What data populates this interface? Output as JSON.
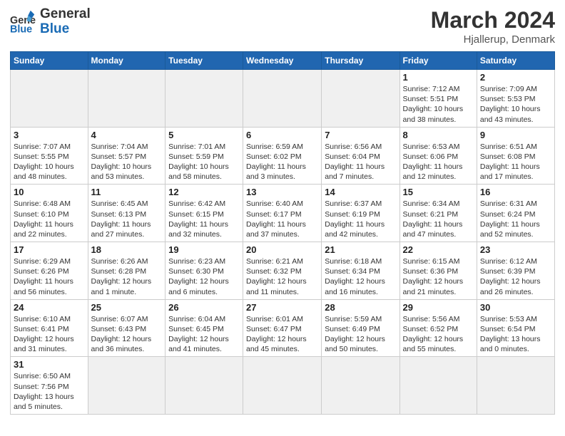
{
  "header": {
    "logo_general": "General",
    "logo_blue": "Blue",
    "month": "March 2024",
    "location": "Hjallerup, Denmark"
  },
  "weekdays": [
    "Sunday",
    "Monday",
    "Tuesday",
    "Wednesday",
    "Thursday",
    "Friday",
    "Saturday"
  ],
  "weeks": [
    [
      {
        "day": "",
        "info": ""
      },
      {
        "day": "",
        "info": ""
      },
      {
        "day": "",
        "info": ""
      },
      {
        "day": "",
        "info": ""
      },
      {
        "day": "",
        "info": ""
      },
      {
        "day": "1",
        "info": "Sunrise: 7:12 AM\nSunset: 5:51 PM\nDaylight: 10 hours and 38 minutes."
      },
      {
        "day": "2",
        "info": "Sunrise: 7:09 AM\nSunset: 5:53 PM\nDaylight: 10 hours and 43 minutes."
      }
    ],
    [
      {
        "day": "3",
        "info": "Sunrise: 7:07 AM\nSunset: 5:55 PM\nDaylight: 10 hours and 48 minutes."
      },
      {
        "day": "4",
        "info": "Sunrise: 7:04 AM\nSunset: 5:57 PM\nDaylight: 10 hours and 53 minutes."
      },
      {
        "day": "5",
        "info": "Sunrise: 7:01 AM\nSunset: 5:59 PM\nDaylight: 10 hours and 58 minutes."
      },
      {
        "day": "6",
        "info": "Sunrise: 6:59 AM\nSunset: 6:02 PM\nDaylight: 11 hours and 3 minutes."
      },
      {
        "day": "7",
        "info": "Sunrise: 6:56 AM\nSunset: 6:04 PM\nDaylight: 11 hours and 7 minutes."
      },
      {
        "day": "8",
        "info": "Sunrise: 6:53 AM\nSunset: 6:06 PM\nDaylight: 11 hours and 12 minutes."
      },
      {
        "day": "9",
        "info": "Sunrise: 6:51 AM\nSunset: 6:08 PM\nDaylight: 11 hours and 17 minutes."
      }
    ],
    [
      {
        "day": "10",
        "info": "Sunrise: 6:48 AM\nSunset: 6:10 PM\nDaylight: 11 hours and 22 minutes."
      },
      {
        "day": "11",
        "info": "Sunrise: 6:45 AM\nSunset: 6:13 PM\nDaylight: 11 hours and 27 minutes."
      },
      {
        "day": "12",
        "info": "Sunrise: 6:42 AM\nSunset: 6:15 PM\nDaylight: 11 hours and 32 minutes."
      },
      {
        "day": "13",
        "info": "Sunrise: 6:40 AM\nSunset: 6:17 PM\nDaylight: 11 hours and 37 minutes."
      },
      {
        "day": "14",
        "info": "Sunrise: 6:37 AM\nSunset: 6:19 PM\nDaylight: 11 hours and 42 minutes."
      },
      {
        "day": "15",
        "info": "Sunrise: 6:34 AM\nSunset: 6:21 PM\nDaylight: 11 hours and 47 minutes."
      },
      {
        "day": "16",
        "info": "Sunrise: 6:31 AM\nSunset: 6:24 PM\nDaylight: 11 hours and 52 minutes."
      }
    ],
    [
      {
        "day": "17",
        "info": "Sunrise: 6:29 AM\nSunset: 6:26 PM\nDaylight: 11 hours and 56 minutes."
      },
      {
        "day": "18",
        "info": "Sunrise: 6:26 AM\nSunset: 6:28 PM\nDaylight: 12 hours and 1 minute."
      },
      {
        "day": "19",
        "info": "Sunrise: 6:23 AM\nSunset: 6:30 PM\nDaylight: 12 hours and 6 minutes."
      },
      {
        "day": "20",
        "info": "Sunrise: 6:21 AM\nSunset: 6:32 PM\nDaylight: 12 hours and 11 minutes."
      },
      {
        "day": "21",
        "info": "Sunrise: 6:18 AM\nSunset: 6:34 PM\nDaylight: 12 hours and 16 minutes."
      },
      {
        "day": "22",
        "info": "Sunrise: 6:15 AM\nSunset: 6:36 PM\nDaylight: 12 hours and 21 minutes."
      },
      {
        "day": "23",
        "info": "Sunrise: 6:12 AM\nSunset: 6:39 PM\nDaylight: 12 hours and 26 minutes."
      }
    ],
    [
      {
        "day": "24",
        "info": "Sunrise: 6:10 AM\nSunset: 6:41 PM\nDaylight: 12 hours and 31 minutes."
      },
      {
        "day": "25",
        "info": "Sunrise: 6:07 AM\nSunset: 6:43 PM\nDaylight: 12 hours and 36 minutes."
      },
      {
        "day": "26",
        "info": "Sunrise: 6:04 AM\nSunset: 6:45 PM\nDaylight: 12 hours and 41 minutes."
      },
      {
        "day": "27",
        "info": "Sunrise: 6:01 AM\nSunset: 6:47 PM\nDaylight: 12 hours and 45 minutes."
      },
      {
        "day": "28",
        "info": "Sunrise: 5:59 AM\nSunset: 6:49 PM\nDaylight: 12 hours and 50 minutes."
      },
      {
        "day": "29",
        "info": "Sunrise: 5:56 AM\nSunset: 6:52 PM\nDaylight: 12 hours and 55 minutes."
      },
      {
        "day": "30",
        "info": "Sunrise: 5:53 AM\nSunset: 6:54 PM\nDaylight: 13 hours and 0 minutes."
      }
    ],
    [
      {
        "day": "31",
        "info": "Sunrise: 6:50 AM\nSunset: 7:56 PM\nDaylight: 13 hours and 5 minutes."
      },
      {
        "day": "",
        "info": ""
      },
      {
        "day": "",
        "info": ""
      },
      {
        "day": "",
        "info": ""
      },
      {
        "day": "",
        "info": ""
      },
      {
        "day": "",
        "info": ""
      },
      {
        "day": "",
        "info": ""
      }
    ]
  ]
}
